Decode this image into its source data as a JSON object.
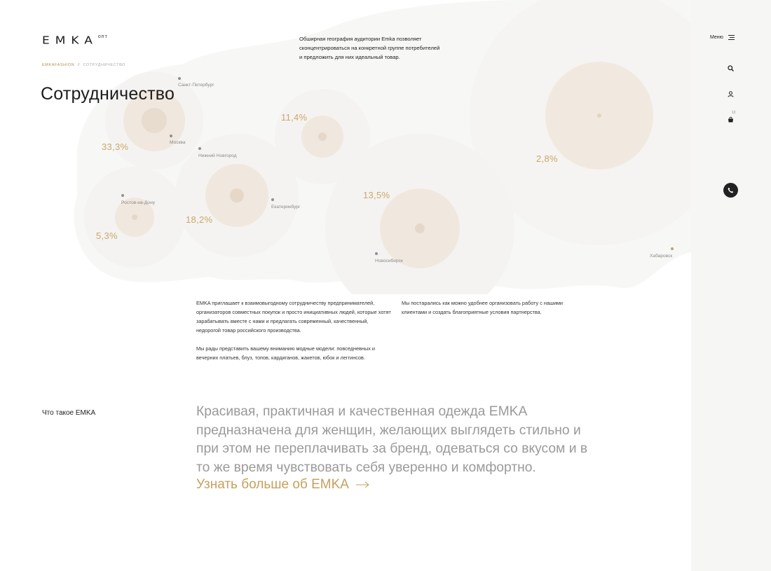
{
  "header": {
    "logo_word": "EMKA",
    "logo_sub": "опт",
    "intro_text": "Обширная география аудитории Emka позволяет сконцентрироваться на конкретной группе потребителей и предложить для них идеальный товар."
  },
  "breadcrumb": {
    "home": "EMKAFASHION",
    "separator": "/",
    "current": "СОТРУДНИЧЕСТВО"
  },
  "page_title": "Сотрудничество",
  "map": {
    "cities": [
      "Санкт-Петербург",
      "Москва",
      "Нижний Новгород",
      "Ростов-на-Дону",
      "Екатеринбург",
      "Новосибирск",
      "Хабаровск"
    ],
    "percents": [
      "11,4%",
      "33,3%",
      "2,8%",
      "13,5%",
      "18,2%",
      "5,3%"
    ],
    "accent_color": "#c9a86a",
    "bubble_color": "#f1e9df"
  },
  "content": {
    "left_paragraphs": [
      "EMKA приглашает к взаимовыгодному сотрудничеству предпринимателей, организаторов совместных покупок и просто инициативных людей, которые хотят зарабатывать вместе с нами и предлагать современный, качественный, недорогой товар российского производства.",
      "Мы рады представить вашему вниманию модные модели: повседневных и вечерних платьев, блуз, топов, кардиганов, жакетов, юбок и леггинсов."
    ],
    "right_paragraph": "Мы постарались как можно удобнее организовать работу с нашими клиентами и создать благоприятные условия партнерства."
  },
  "about": {
    "label": "Что такое EMKA",
    "text": "Красивая, практичная и качественная одежда EMKA предназначена для женщин, желающих выглядеть стильно и при этом не переплачивать за бренд, одеваться со вкусом и в то же время чувствовать себя уверенно и комфортно.",
    "link_label": "Узнать больше об EMKA"
  },
  "sidebar": {
    "menu_label": "Меню",
    "cart_count": "12",
    "icons": [
      "search-icon",
      "user-icon",
      "cart-icon",
      "phone-icon"
    ]
  }
}
